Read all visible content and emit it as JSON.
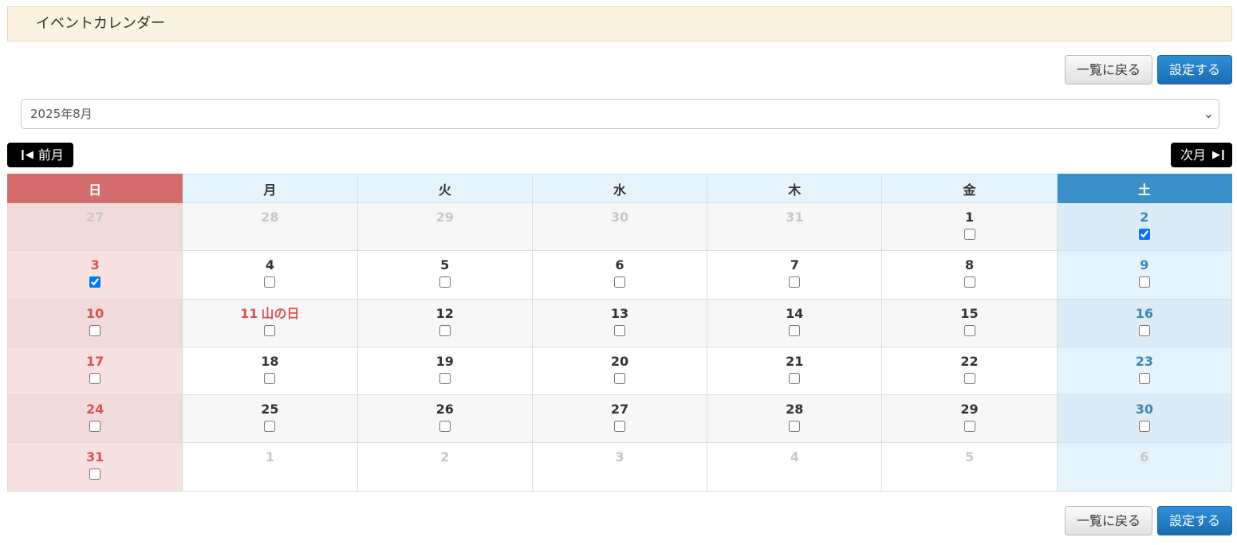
{
  "page_title": "イベントカレンダー",
  "buttons": {
    "back_label": "一覧に戻る",
    "save_label": "設定する"
  },
  "month_select": {
    "selected": "2025年8月"
  },
  "nav": {
    "prev_label": "前月",
    "next_label": "次月"
  },
  "weekdays": [
    "日",
    "月",
    "火",
    "水",
    "木",
    "金",
    "土"
  ],
  "weeks": [
    [
      {
        "day": "27",
        "other": true
      },
      {
        "day": "28",
        "other": true
      },
      {
        "day": "29",
        "other": true
      },
      {
        "day": "30",
        "other": true
      },
      {
        "day": "31",
        "other": true
      },
      {
        "day": "1",
        "checked": false
      },
      {
        "day": "2",
        "checked": true
      }
    ],
    [
      {
        "day": "3",
        "checked": true
      },
      {
        "day": "4",
        "checked": false
      },
      {
        "day": "5",
        "checked": false
      },
      {
        "day": "6",
        "checked": false
      },
      {
        "day": "7",
        "checked": false
      },
      {
        "day": "8",
        "checked": false
      },
      {
        "day": "9",
        "checked": false
      }
    ],
    [
      {
        "day": "10",
        "checked": false
      },
      {
        "day": "11",
        "checked": false,
        "holiday": "山の日"
      },
      {
        "day": "12",
        "checked": false
      },
      {
        "day": "13",
        "checked": false
      },
      {
        "day": "14",
        "checked": false
      },
      {
        "day": "15",
        "checked": false
      },
      {
        "day": "16",
        "checked": false
      }
    ],
    [
      {
        "day": "17",
        "checked": false
      },
      {
        "day": "18",
        "checked": false
      },
      {
        "day": "19",
        "checked": false
      },
      {
        "day": "20",
        "checked": false
      },
      {
        "day": "21",
        "checked": false
      },
      {
        "day": "22",
        "checked": false
      },
      {
        "day": "23",
        "checked": false
      }
    ],
    [
      {
        "day": "24",
        "checked": false
      },
      {
        "day": "25",
        "checked": false
      },
      {
        "day": "26",
        "checked": false
      },
      {
        "day": "27",
        "checked": false
      },
      {
        "day": "28",
        "checked": false
      },
      {
        "day": "29",
        "checked": false
      },
      {
        "day": "30",
        "checked": false
      }
    ],
    [
      {
        "day": "31",
        "checked": false
      },
      {
        "day": "1",
        "other": true
      },
      {
        "day": "2",
        "other": true
      },
      {
        "day": "3",
        "other": true
      },
      {
        "day": "4",
        "other": true
      },
      {
        "day": "5",
        "other": true
      },
      {
        "day": "6",
        "other": true
      }
    ]
  ]
}
